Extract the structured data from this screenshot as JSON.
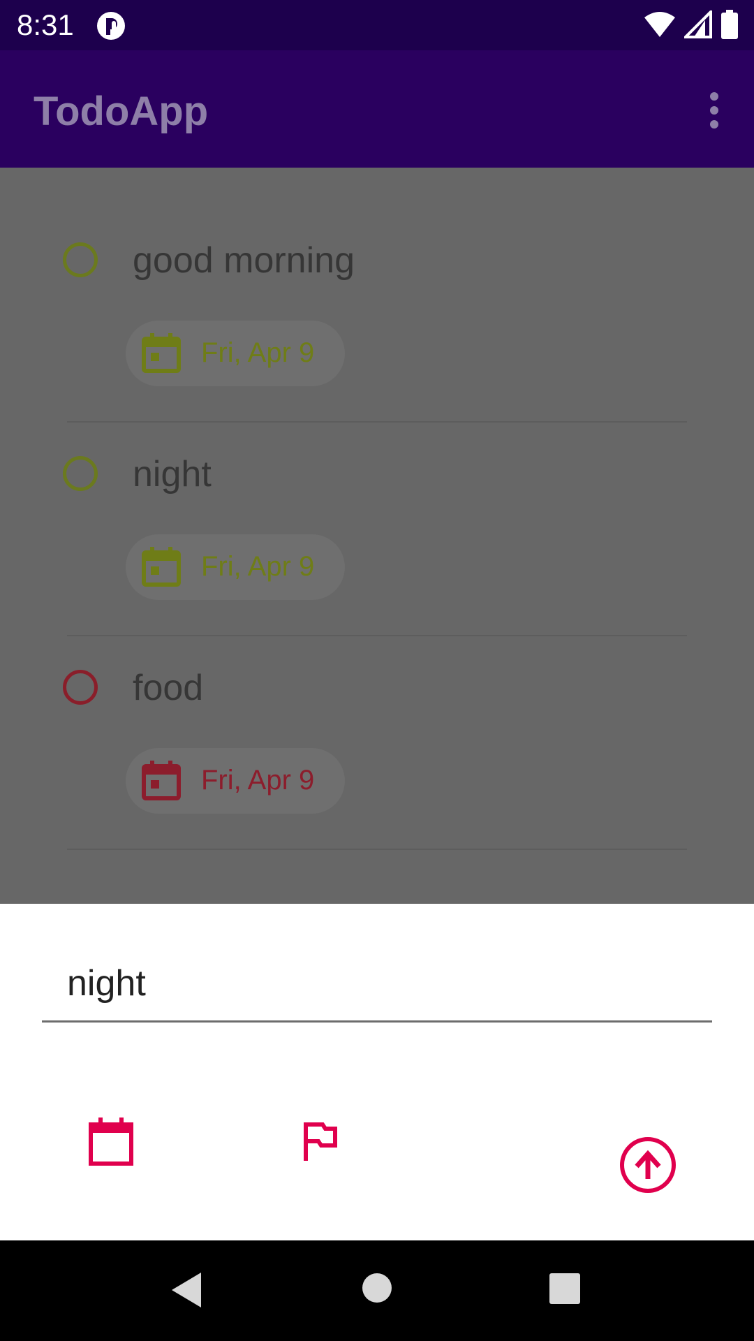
{
  "status_bar": {
    "time": "8:31"
  },
  "app_bar": {
    "title": "TodoApp",
    "menu_icon": "more-vert-icon"
  },
  "todos": [
    {
      "title": "good morning",
      "date": "Fri, Apr 9",
      "accent": "#6b7a1e",
      "date_color": "#6f7d17"
    },
    {
      "title": "night",
      "date": "Fri, Apr 9",
      "accent": "#6b7a1e",
      "date_color": "#6f7d17"
    },
    {
      "title": "food",
      "date": "Fri, Apr 9",
      "accent": "#8a1e2a",
      "date_color": "#8c1d2c"
    }
  ],
  "sheet": {
    "input_value": "night",
    "accent": "#e0004d",
    "icons": [
      "calendar-icon",
      "flag-icon",
      "arrow-up-circle-icon"
    ]
  },
  "colors": {
    "status_bar": "#1d004d",
    "app_bar": "#2a005f",
    "scrim": "#676767"
  }
}
